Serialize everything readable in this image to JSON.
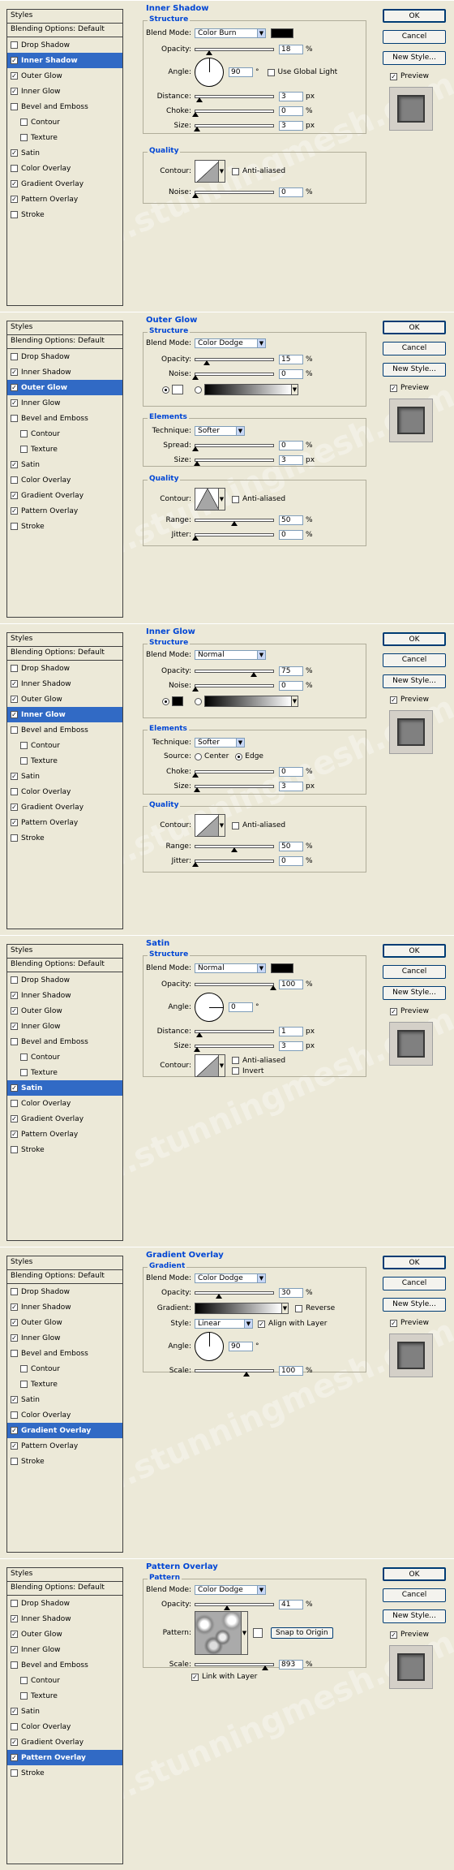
{
  "watermark": "www.stunningmesh.com",
  "buttons": {
    "ok": "OK",
    "cancel": "Cancel",
    "new_style": "New Style...",
    "preview": "Preview"
  },
  "styles_list": {
    "title": "Styles",
    "blending": "Blending Options: Default",
    "items": [
      "Drop Shadow",
      "Inner Shadow",
      "Outer Glow",
      "Inner Glow",
      "Bevel and Emboss",
      "Contour",
      "Texture",
      "Satin",
      "Color Overlay",
      "Gradient Overlay",
      "Pattern Overlay",
      "Stroke"
    ]
  },
  "panels": [
    {
      "section": "Inner Shadow",
      "selected": 1,
      "checked": [
        1,
        2,
        3,
        7,
        9,
        10
      ],
      "structure": "Structure",
      "blend_label": "Blend Mode:",
      "blend": "Color Burn",
      "opacity_label": "Opacity:",
      "opacity": "18",
      "angle_label": "Angle:",
      "angle": "90",
      "global_light": "Use Global Light",
      "distance_label": "Distance:",
      "distance": "3",
      "choke_label": "Choke:",
      "choke": "0",
      "size_label": "Size:",
      "size": "3",
      "quality": "Quality",
      "contour_label": "Contour:",
      "anti_aliased": "Anti-aliased",
      "noise_label": "Noise:",
      "noise": "0"
    },
    {
      "section": "Outer Glow",
      "selected": 2,
      "checked": [
        1,
        2,
        3,
        7,
        9,
        10
      ],
      "structure": "Structure",
      "blend_label": "Blend Mode:",
      "blend": "Color Dodge",
      "opacity_label": "Opacity:",
      "opacity": "15",
      "noise_label": "Noise:",
      "noise": "0",
      "elements": "Elements",
      "technique_label": "Technique:",
      "technique": "Softer",
      "spread_label": "Spread:",
      "spread": "0",
      "size_label": "Size:",
      "size": "3",
      "quality": "Quality",
      "contour_label": "Contour:",
      "anti_aliased": "Anti-aliased",
      "range_label": "Range:",
      "range": "50",
      "jitter_label": "Jitter:",
      "jitter": "0"
    },
    {
      "section": "Inner Glow",
      "selected": 3,
      "checked": [
        1,
        2,
        3,
        7,
        9,
        10
      ],
      "structure": "Structure",
      "blend_label": "Blend Mode:",
      "blend": "Normal",
      "opacity_label": "Opacity:",
      "opacity": "75",
      "noise_label": "Noise:",
      "noise": "0",
      "elements": "Elements",
      "technique_label": "Technique:",
      "technique": "Softer",
      "source_label": "Source:",
      "center": "Center",
      "edge": "Edge",
      "choke_label": "Choke:",
      "choke": "0",
      "size_label": "Size:",
      "size": "3",
      "quality": "Quality",
      "contour_label": "Contour:",
      "anti_aliased": "Anti-aliased",
      "range_label": "Range:",
      "range": "50",
      "jitter_label": "Jitter:",
      "jitter": "0"
    },
    {
      "section": "Satin",
      "selected": 7,
      "checked": [
        1,
        2,
        3,
        7,
        9,
        10
      ],
      "structure": "Structure",
      "blend_label": "Blend Mode:",
      "blend": "Normal",
      "opacity_label": "Opacity:",
      "opacity": "100",
      "angle_label": "Angle:",
      "angle": "0",
      "distance_label": "Distance:",
      "distance": "1",
      "size_label": "Size:",
      "size": "3",
      "contour_label": "Contour:",
      "anti_aliased": "Anti-aliased",
      "invert": "Invert"
    },
    {
      "section": "Gradient Overlay",
      "selected": 9,
      "checked": [
        1,
        2,
        3,
        7,
        9,
        10
      ],
      "structure": "Gradient",
      "blend_label": "Blend Mode:",
      "blend": "Color Dodge",
      "opacity_label": "Opacity:",
      "opacity": "30",
      "gradient_label": "Gradient:",
      "reverse": "Reverse",
      "style_label": "Style:",
      "style": "Linear",
      "align": "Align with Layer",
      "angle_label": "Angle:",
      "angle": "90",
      "scale_label": "Scale:",
      "scale": "100"
    },
    {
      "section": "Pattern Overlay",
      "selected": 10,
      "checked": [
        1,
        2,
        3,
        7,
        9,
        10
      ],
      "structure": "Pattern",
      "blend_label": "Blend Mode:",
      "blend": "Color Dodge",
      "opacity_label": "Opacity:",
      "opacity": "41",
      "pattern_label": "Pattern:",
      "snap": "Snap to Origin",
      "scale_label": "Scale:",
      "scale": "893",
      "link": "Link with Layer"
    }
  ]
}
